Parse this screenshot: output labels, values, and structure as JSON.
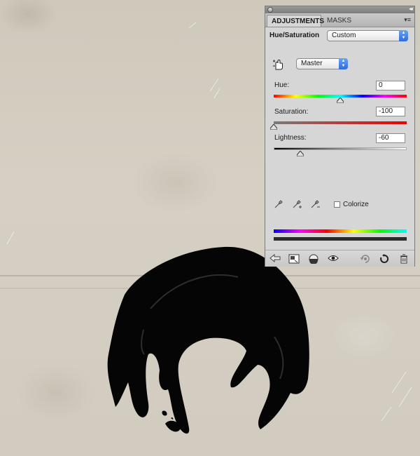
{
  "panel": {
    "tabs": [
      {
        "label": "ADJUSTMENTS",
        "active": true
      },
      {
        "label": "MASKS",
        "active": false
      }
    ],
    "collapse_glyph": "◂◂",
    "menu_glyph": "▾≡",
    "adjustment_title": "Hue/Saturation",
    "preset_value": "Custom",
    "channel_value": "Master",
    "hue": {
      "label": "Hue:",
      "value": "0",
      "slider_fraction": 0.5
    },
    "saturation": {
      "label": "Saturation:",
      "value": "-100",
      "slider_fraction": 0.0
    },
    "lightness": {
      "label": "Lightness:",
      "value": "-60",
      "slider_fraction": 0.2
    },
    "colorize": {
      "label": "Colorize",
      "checked": false
    },
    "icons": {
      "hand": "targeted-adjustment-hand-icon",
      "droppers": [
        "eyedropper-icon",
        "eyedropper-plus-icon",
        "eyedropper-minus-icon"
      ],
      "toolbar": [
        "back-arrow-icon",
        "expand-view-icon",
        "clip-to-layer-icon",
        "visibility-eye-icon",
        "view-previous-icon",
        "reset-icon",
        "trash-icon"
      ]
    },
    "colors": {
      "select_accent": "#2f6cd9",
      "saturation_end": "#ee0000"
    }
  }
}
